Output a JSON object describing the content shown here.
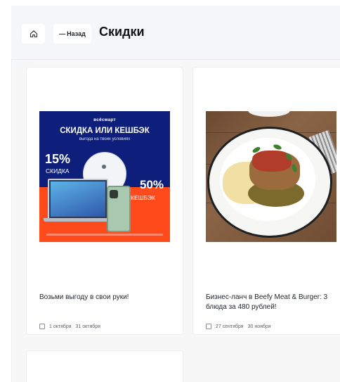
{
  "header": {
    "back_label": "Назад",
    "back_prefix": "—",
    "title": "Скидки"
  },
  "cards": [
    {
      "title": "Возьми выгоду в свои руки!",
      "date_start": "1 октября",
      "date_end": "31 октября",
      "image": {
        "brand": "всёсмарт",
        "headline": "СКИДКА ИЛИ КЕШБЭК",
        "subline": "выгода на твоих условиях",
        "left_percent": "15%",
        "left_caption": "СКИДКА",
        "right_percent": "50%",
        "right_caption": "КЕШБЭК"
      }
    },
    {
      "title": "Бизнес-ланч в Beefy Meat & Burger: 3 блюда за 480 рублей!",
      "date_start": "27 сентября",
      "date_end": "30 ноября"
    }
  ],
  "colors": {
    "promo_blue": "#0d1f7a",
    "promo_orange": "#ff4b1c",
    "page_bg": "#f7f7f8"
  }
}
